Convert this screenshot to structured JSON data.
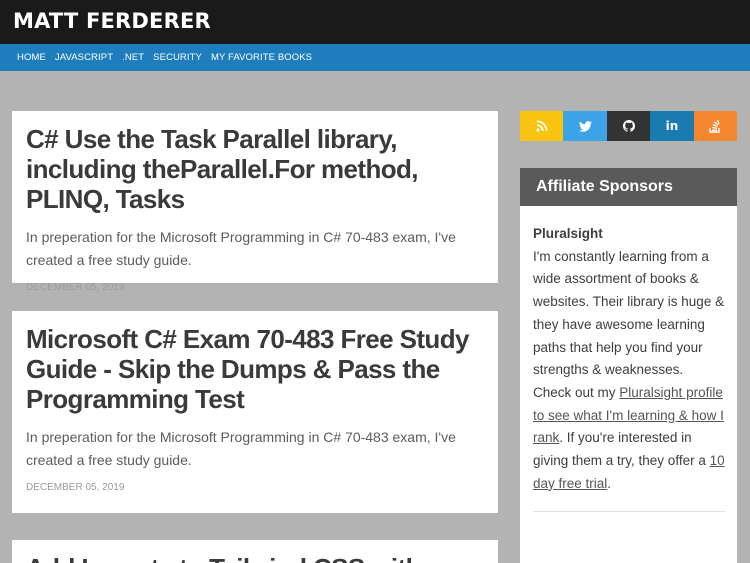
{
  "site": {
    "title": "MATT FERDERER"
  },
  "nav": [
    {
      "label": "HOME"
    },
    {
      "label": "JAVASCRIPT"
    },
    {
      "label": ".NET"
    },
    {
      "label": "SECURITY"
    },
    {
      "label": "MY FAVORITE BOOKS"
    }
  ],
  "posts": [
    {
      "title": "C# Use the Task Parallel library, including theParallel.For method, PLINQ, Tasks",
      "excerpt": "In preperation for the Microsoft Programming in C# 70-483 exam, I've created a free study guide.",
      "date": "DECEMBER 05, 2019"
    },
    {
      "title": "Microsoft C# Exam 70-483 Free Study Guide - Skip the Dumps & Pass the Programming Test",
      "excerpt": "In preperation for the Microsoft Programming in C# 70-483 exam, I've created a free study guide.",
      "date": "DECEMBER 05, 2019"
    },
    {
      "title": "Add Imports to Tailwind CSS with"
    }
  ],
  "social": [
    {
      "name": "rss-icon",
      "glyph": "◖"
    },
    {
      "name": "twitter-icon",
      "glyph": "🕊"
    },
    {
      "name": "github-icon",
      "glyph": "●"
    },
    {
      "name": "linkedin-icon",
      "glyph": "in"
    },
    {
      "name": "stackoverflow-icon",
      "glyph": "≡"
    }
  ],
  "sidebar": {
    "heading": "Affiliate Sponsors",
    "sponsor_name": "Pluralsight",
    "text_1": "I'm constantly learning from a wide assortment of books & websites. Their library is huge & they have awesome learning paths that help you find your strengths & weaknesses. Check out my ",
    "link_profile": "Pluralsight profile to see what I'm learning & how I rank",
    "text_2": ". If you're interested in giving them a try, they offer a ",
    "link_trial": "10 day free trial",
    "text_3": "."
  }
}
